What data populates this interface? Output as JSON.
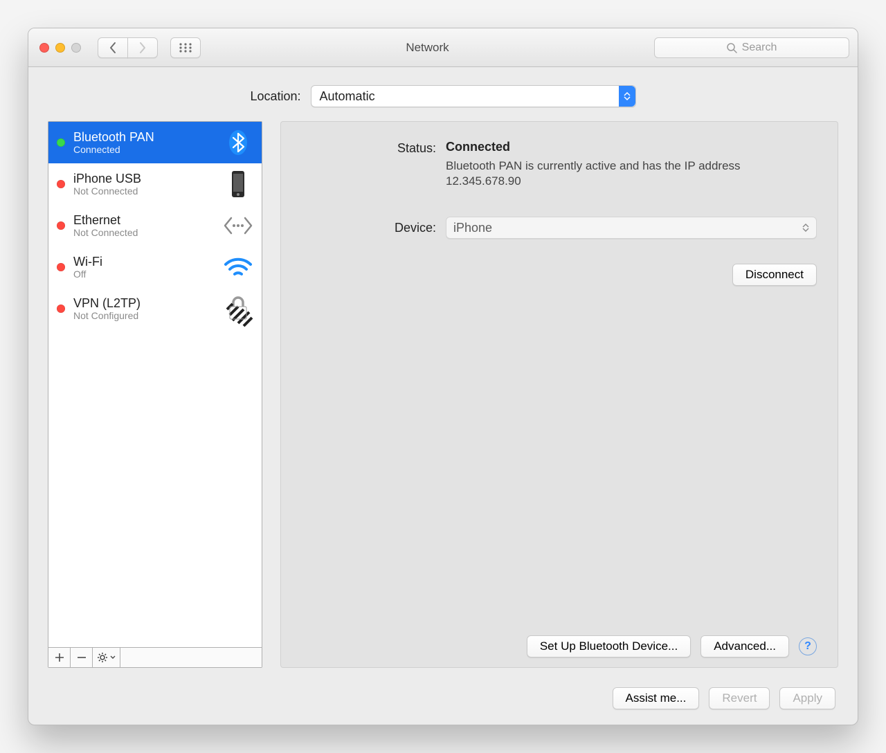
{
  "window": {
    "title": "Network"
  },
  "toolbar": {
    "search_placeholder": "Search"
  },
  "location": {
    "label": "Location:",
    "value": "Automatic"
  },
  "sidebar": {
    "items": [
      {
        "name": "Bluetooth PAN",
        "sub": "Connected",
        "status": "green",
        "icon": "bluetooth",
        "selected": true
      },
      {
        "name": "iPhone USB",
        "sub": "Not Connected",
        "status": "red",
        "icon": "iphone"
      },
      {
        "name": "Ethernet",
        "sub": "Not Connected",
        "status": "red",
        "icon": "ethernet"
      },
      {
        "name": "Wi-Fi",
        "sub": "Off",
        "status": "red",
        "icon": "wifi"
      },
      {
        "name": "VPN (L2TP)",
        "sub": "Not Configured",
        "status": "red",
        "icon": "vpn"
      }
    ]
  },
  "details": {
    "status_label": "Status:",
    "status_value": "Connected",
    "status_desc": "Bluetooth PAN is currently active and has the IP address 12.345.678.90",
    "device_label": "Device:",
    "device_value": "iPhone",
    "disconnect": "Disconnect",
    "setup": "Set Up Bluetooth Device...",
    "advanced": "Advanced...",
    "help": "?"
  },
  "footer": {
    "assist": "Assist me...",
    "revert": "Revert",
    "apply": "Apply"
  }
}
